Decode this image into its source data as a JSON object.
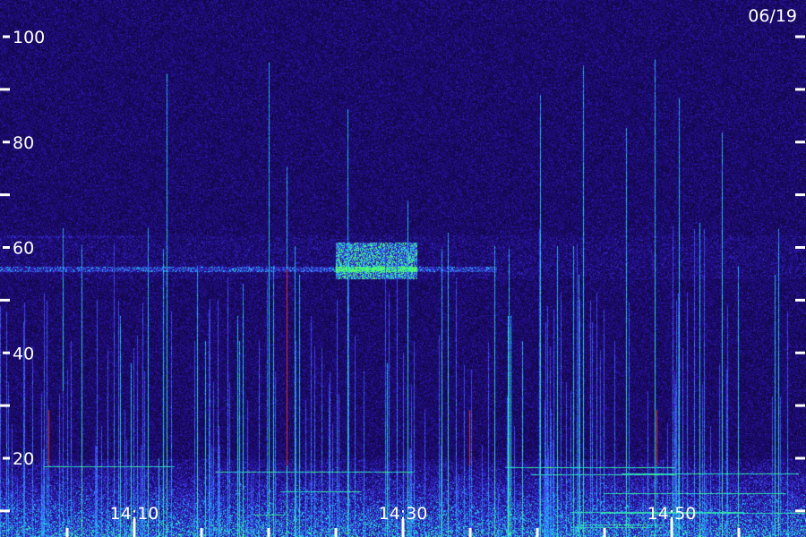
{
  "date_label": "06/19",
  "colors": {
    "background": "#1a0b5c",
    "band": "#3a34e0",
    "spike_cyan": "#3ad6e8",
    "spike_green": "#55ff66",
    "spike_red": "#e03030",
    "text": "#ffffff"
  },
  "chart_data": {
    "type": "heatmap",
    "title": "",
    "xlabel": "",
    "ylabel": "",
    "y_axis": {
      "ylim": [
        0,
        110
      ],
      "major_ticks": [
        20,
        40,
        60,
        80,
        100
      ],
      "major_tick_labels": [
        "20",
        "40",
        "60",
        "80",
        "100"
      ],
      "minor_ticks": [
        10,
        30,
        50,
        70,
        90
      ]
    },
    "x_axis": {
      "xlim": [
        "14:00",
        "15:00"
      ],
      "tick_labels": [
        "14:10",
        "14:30",
        "14:50"
      ],
      "tick_times": [
        "14:10",
        "14:30",
        "14:50"
      ],
      "minor_tick_times": [
        "14:05",
        "14:15",
        "14:20",
        "14:25",
        "14:35",
        "14:40",
        "14:45",
        "14:55"
      ]
    },
    "grid": false,
    "features": {
      "horizontal_band": {
        "frequency": 56,
        "start": "14:00",
        "end": "14:37"
      },
      "burst": {
        "frequency_range": [
          54,
          61
        ],
        "start": "14:25",
        "end": "14:31"
      },
      "low_frequency_noise_ceiling": 20
    }
  }
}
